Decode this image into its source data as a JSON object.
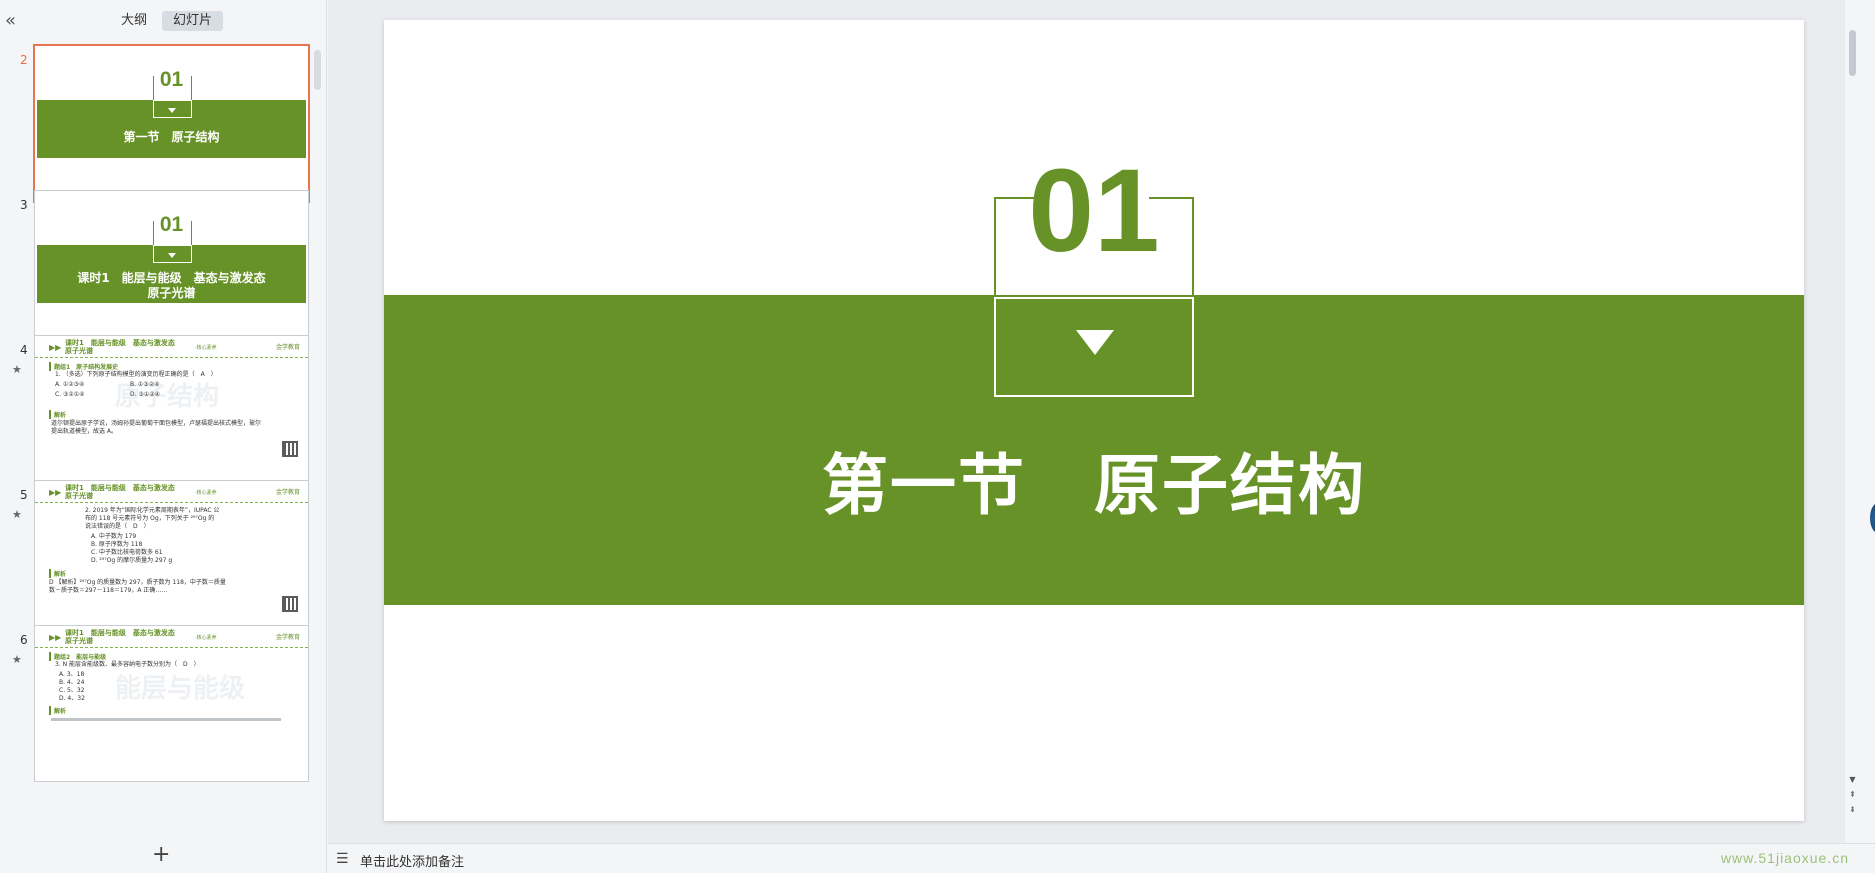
{
  "left_panel": {
    "collapse_icon": "«",
    "tabs": [
      {
        "label": "大纲",
        "active": false
      },
      {
        "label": "幻灯片",
        "active": true
      }
    ],
    "add_icon": "+"
  },
  "thumbnails": [
    {
      "num": "2",
      "kind": "title",
      "number": "01",
      "title": "第一节　原子结构",
      "selected": true
    },
    {
      "num": "3",
      "kind": "title",
      "number": "01",
      "title_line1": "课时1　能层与能级　基态与激发态",
      "title_line2": "原子光谱"
    },
    {
      "num": "4",
      "kind": "content",
      "star": "★",
      "head_title_1": "课时1　能层与能级　基态与激发态",
      "head_title_2": "原子光谱",
      "head_mid": "·核心素养",
      "logo": "金学教育",
      "section": "题组1　原子结构发展史",
      "section2": "解析",
      "q": "1. （多选）下列原子结构模型的演变历程正确的是（　A　）",
      "opts": [
        "A. ①②③④",
        "B. ①③②④",
        "C. ③②①④",
        "D. ③①②④"
      ],
      "ans": "道尔顿提出原子学说，汤姆孙提出葡萄干面包模型，卢瑟福提出核式模型，玻尔提出轨道模型，故选 A。",
      "wm": "原子结构"
    },
    {
      "num": "5",
      "kind": "content",
      "star": "★",
      "head_title_1": "课时1　能层与能级　基态与激发态",
      "head_title_2": "原子光谱",
      "head_mid": "·核心素养",
      "logo": "金学教育",
      "section2": "解析",
      "q": "2. 2019 年为“国际化学元素周期表年”，IUPAC 公布的 118 号元素符号为 Og，下列关于 ²⁹⁷Og 的说法错误的是（　D　）",
      "opts": [
        "A. 中子数为 179",
        "B. 原子序数为 118",
        "C. 中子数比核电荷数多 61",
        "D. ²⁹⁷Og 的摩尔质量为 297 g"
      ],
      "ans": "D 【解析】²⁹⁷Og 的质量数为 297，质子数为 118，中子数＝质量数－质子数＝297－118＝179，A 正确……",
      "wm": ""
    },
    {
      "num": "6",
      "kind": "content",
      "star": "★",
      "head_title_1": "课时1　能层与能级　基态与激发态",
      "head_title_2": "原子光谱",
      "head_mid": "·核心素养",
      "logo": "金学教育",
      "section": "题组2　能层与能级",
      "section2": "解析",
      "q": "3. N 能层含能级数、最多容纳电子数分别为（　D　）",
      "opts": [
        "A. 3、18",
        "B. 4、24",
        "C. 5、32",
        "D. 4、32"
      ],
      "ans": "",
      "wm": "能层与能级"
    }
  ],
  "slide": {
    "number": "01",
    "title": "第一节　原子结构",
    "accent": "#679227"
  },
  "notes_bar": {
    "icon": "notes-list-icon",
    "placeholder": "单击此处添加备注",
    "watermark": "www.51jiaoxue.cn"
  }
}
